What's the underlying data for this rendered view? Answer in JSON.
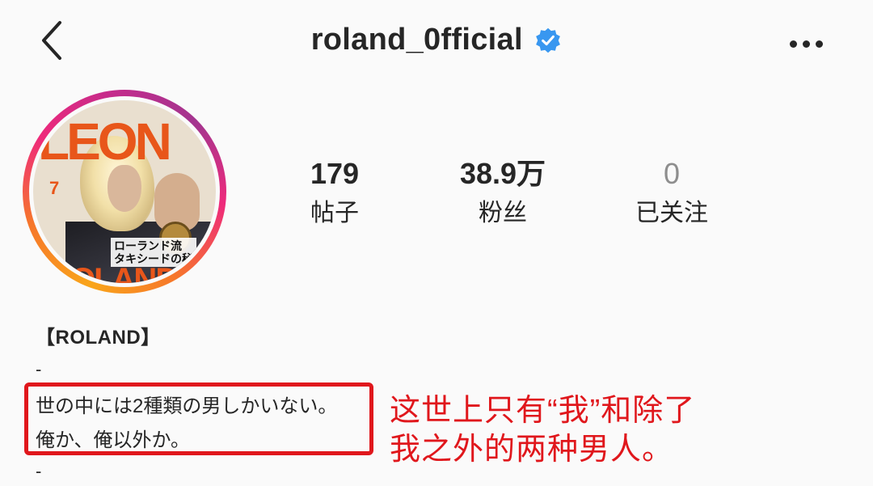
{
  "header": {
    "title": "roland_0fficial",
    "verified_icon": "verified-badge-icon",
    "back_icon": "chevron-left-icon",
    "more_icon": "more-horizontal-icon"
  },
  "avatar": {
    "description_icon": "profile-photo-avatar"
  },
  "stats": [
    {
      "value": "179",
      "label": "帖子"
    },
    {
      "value": "38.9万",
      "label": "粉丝"
    },
    {
      "value": "0",
      "label": "已关注"
    }
  ],
  "bio": {
    "name": "【ROLAND】",
    "dash1": "-",
    "line1": "世の中には2種類の男しかいない。",
    "line2": "俺か、俺以外か。",
    "dash2": "-"
  },
  "annotation": {
    "line1": "这世上只有“我”和除了",
    "line2": "我之外的两种男人。"
  },
  "colors": {
    "background": "#fafafa",
    "text": "#262626",
    "verified_blue": "#3897f0",
    "highlight_red": "#e0171c",
    "muted": "#8e8e8e"
  }
}
